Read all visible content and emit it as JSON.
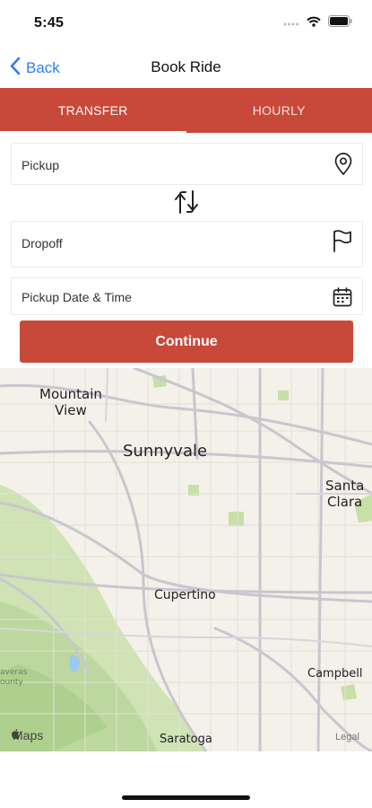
{
  "status_bar": {
    "time": "5:45"
  },
  "nav": {
    "back_label": "Back",
    "title": "Book Ride"
  },
  "tabs": [
    {
      "label": "TRANSFER",
      "active": true
    },
    {
      "label": "HOURLY",
      "active": false
    }
  ],
  "form": {
    "pickup": {
      "label": "Pickup",
      "icon": "location-pin-icon"
    },
    "swap_icon": "swap-arrows-icon",
    "dropoff": {
      "label": "Dropoff",
      "icon": "flag-icon"
    },
    "date": {
      "label": "Pickup Date & Time",
      "icon": "calendar-icon"
    },
    "continue_label": "Continue"
  },
  "map": {
    "labels": {
      "mountain_view": "Mountain\nView",
      "sunnyvale": "Sunnyvale",
      "santa_clara": "Santa\nClara",
      "cupertino": "Cupertino",
      "campbell": "Campbell",
      "saratoga": "Saratoga",
      "county": "averas\nounty"
    },
    "brand": "Maps",
    "legal": "Legal"
  },
  "colors": {
    "accent": "#c8493a",
    "link": "#2f7df6"
  }
}
